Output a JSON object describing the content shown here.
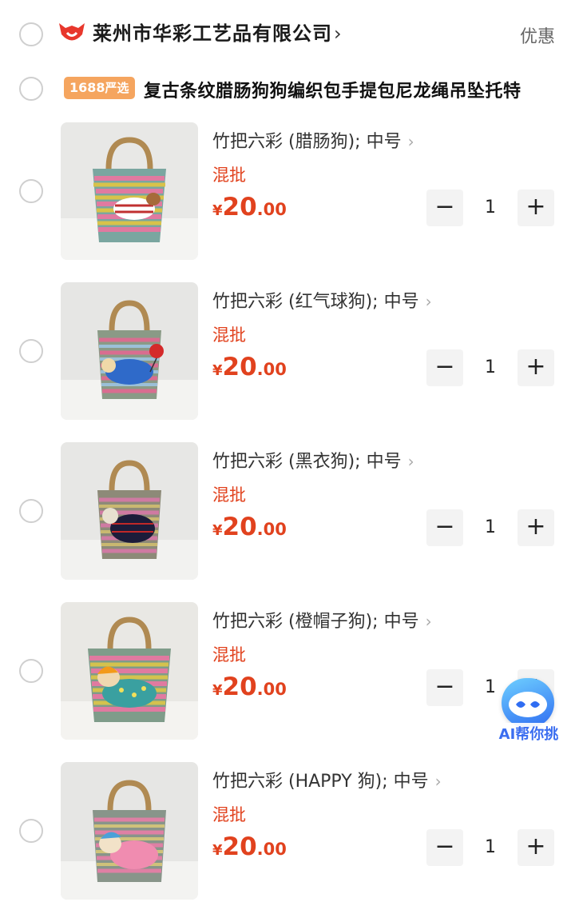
{
  "store": {
    "name": "莱州市华彩工艺品有限公司",
    "chevron": "›",
    "discount_label": "优惠",
    "logo_color": "#e8372c"
  },
  "product": {
    "badge_number": "1688",
    "badge_text": "严选",
    "title": "复古条纹腊肠狗狗编织包手提包尼龙绳吊坠托特"
  },
  "items": [
    {
      "variant": "竹把六彩 (腊肠狗); 中号",
      "tag": "混批",
      "currency": "¥",
      "price_int": "20",
      "price_dec": ".00",
      "qty": "1",
      "image": "bag-dachshund-striped-sweater"
    },
    {
      "variant": "竹把六彩 (红气球狗); 中号",
      "tag": "混批",
      "currency": "¥",
      "price_int": "20",
      "price_dec": ".00",
      "qty": "1",
      "image": "bag-dog-red-balloon"
    },
    {
      "variant": "竹把六彩 (黑衣狗); 中号",
      "tag": "混批",
      "currency": "¥",
      "price_int": "20",
      "price_dec": ".00",
      "qty": "1",
      "image": "bag-dog-black-coat"
    },
    {
      "variant": "竹把六彩 (橙帽子狗); 中号",
      "tag": "混批",
      "currency": "¥",
      "price_int": "20",
      "price_dec": ".00",
      "qty": "1",
      "image": "bag-dog-orange-hat"
    },
    {
      "variant": "竹把六彩 (HAPPY 狗); 中号",
      "tag": "混批",
      "currency": "¥",
      "price_int": "20",
      "price_dec": ".00",
      "qty": "1",
      "image": "bag-dog-happy"
    }
  ],
  "controls": {
    "minus": "−",
    "plus": "+",
    "item_chevron": "›"
  },
  "ai_button": {
    "label": "AI帮你挑"
  },
  "colors": {
    "accent": "#e1421e",
    "badge": "#f5a55f",
    "ai_blue": "#3b6ef0"
  }
}
